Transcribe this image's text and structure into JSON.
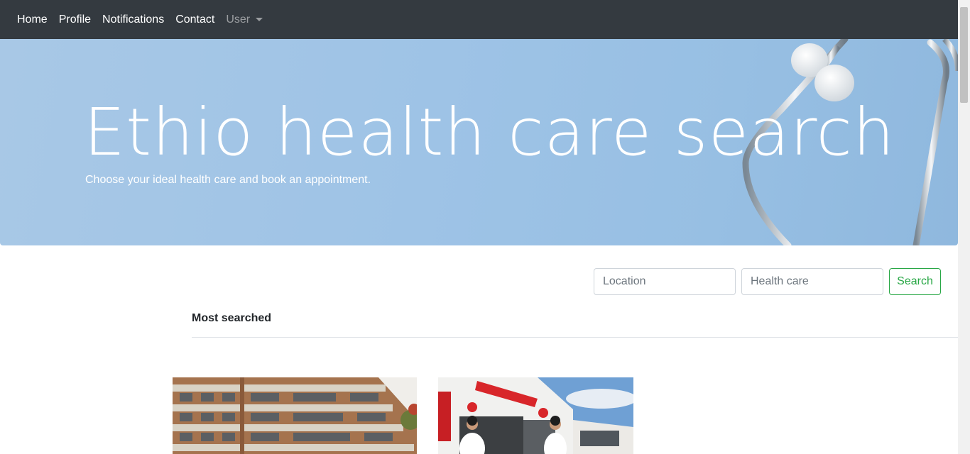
{
  "navbar": {
    "items": [
      {
        "label": "Home"
      },
      {
        "label": "Profile"
      },
      {
        "label": "Notifications"
      },
      {
        "label": "Contact"
      }
    ],
    "user_dropdown": {
      "label": "User"
    }
  },
  "hero": {
    "title": "Ethio health care search",
    "subtitle": "Choose your ideal health care and book an appointment."
  },
  "search": {
    "location_placeholder": "Location",
    "healthcare_placeholder": "Health care",
    "button_label": "Search"
  },
  "most_searched": {
    "title": "Most searched",
    "cards": [
      {
        "image": "hospital-building-image"
      },
      {
        "image": "clinic-entrance-image"
      }
    ]
  },
  "colors": {
    "navbar_bg": "#343a40",
    "hero_bg": "#9ec3e6",
    "search_button": "#28a745"
  }
}
